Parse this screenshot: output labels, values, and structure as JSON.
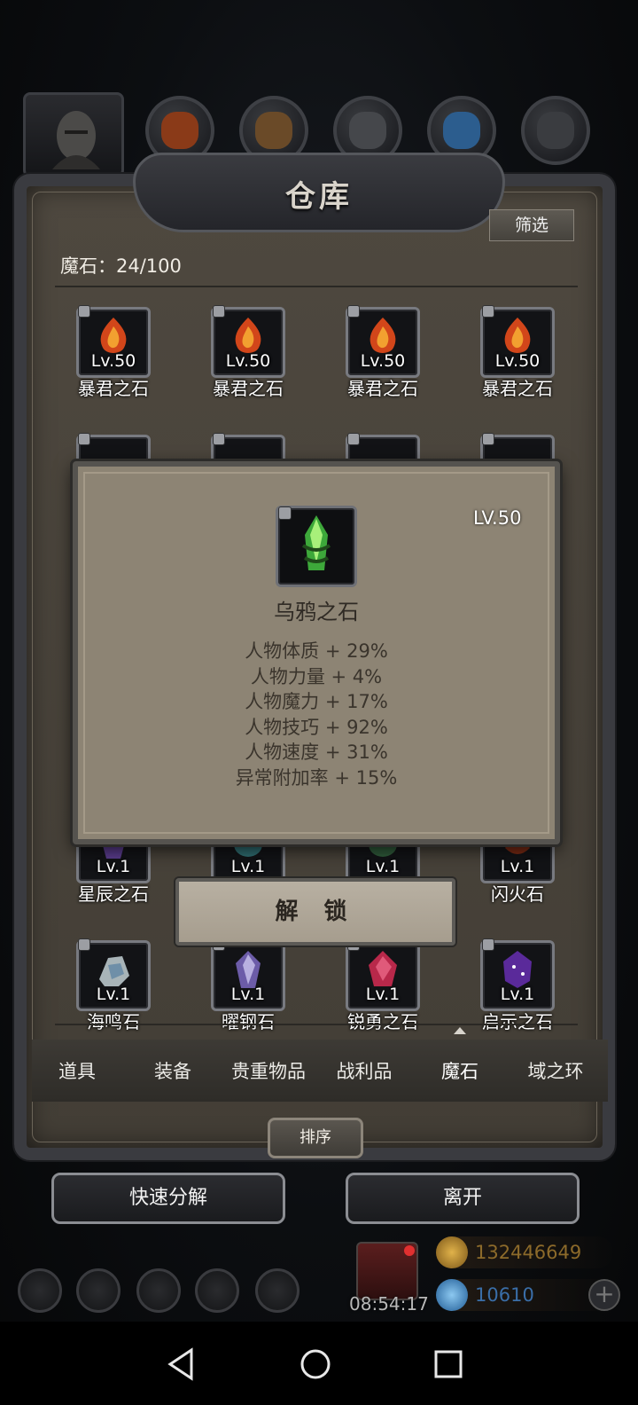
{
  "title": "仓库",
  "filter_label": "筛选",
  "count_label": "魔石：24/100",
  "rows": [
    {
      "items": [
        {
          "level": "Lv.50",
          "name": "暴君之石",
          "gem": "fire"
        },
        {
          "level": "Lv.50",
          "name": "暴君之石",
          "gem": "fire"
        },
        {
          "level": "Lv.50",
          "name": "暴君之石",
          "gem": "fire"
        },
        {
          "level": "Lv.50",
          "name": "暴君之石",
          "gem": "fire"
        }
      ]
    },
    {
      "items": [
        {
          "level": "Lv.1",
          "name": "星辰之石",
          "gem": "star"
        },
        {
          "level": "Lv.1",
          "name": "",
          "gem": "teal"
        },
        {
          "level": "Lv.1",
          "name": "",
          "gem": "green"
        },
        {
          "level": "Lv.1",
          "name": "闪火石",
          "gem": "ember"
        }
      ]
    },
    {
      "items": [
        {
          "level": "Lv.1",
          "name": "海鸣石",
          "gem": "pearl"
        },
        {
          "level": "Lv.1",
          "name": "曜钢石",
          "gem": "crystal"
        },
        {
          "level": "Lv.1",
          "name": "锐勇之石",
          "gem": "ruby"
        },
        {
          "level": "Lv.1",
          "name": "启示之石",
          "gem": "violet"
        }
      ]
    }
  ],
  "tabs": [
    {
      "label": "道具"
    },
    {
      "label": "装备"
    },
    {
      "label": "贵重物品"
    },
    {
      "label": "战利品"
    },
    {
      "label": "魔石"
    },
    {
      "label": "域之环"
    }
  ],
  "sort_label": "排序",
  "quick_decompose_label": "快速分解",
  "leave_label": "离开",
  "time": "08:54:17",
  "gold": "132446649",
  "gems": "10610",
  "popup": {
    "level": "LV.50",
    "name": "乌鸦之石",
    "stats": [
      "人物体质 + 29%",
      "人物力量 + 4%",
      "人物魔力 + 17%",
      "人物技巧 + 92%",
      "人物速度 + 31%",
      "异常附加率 + 15%"
    ],
    "unlock_label": "解 锁"
  },
  "colors": {
    "panel": "#433e36",
    "popup_bg": "#8d8474",
    "gold": "#b08a3a",
    "gem_blue": "#3a6ea8"
  }
}
